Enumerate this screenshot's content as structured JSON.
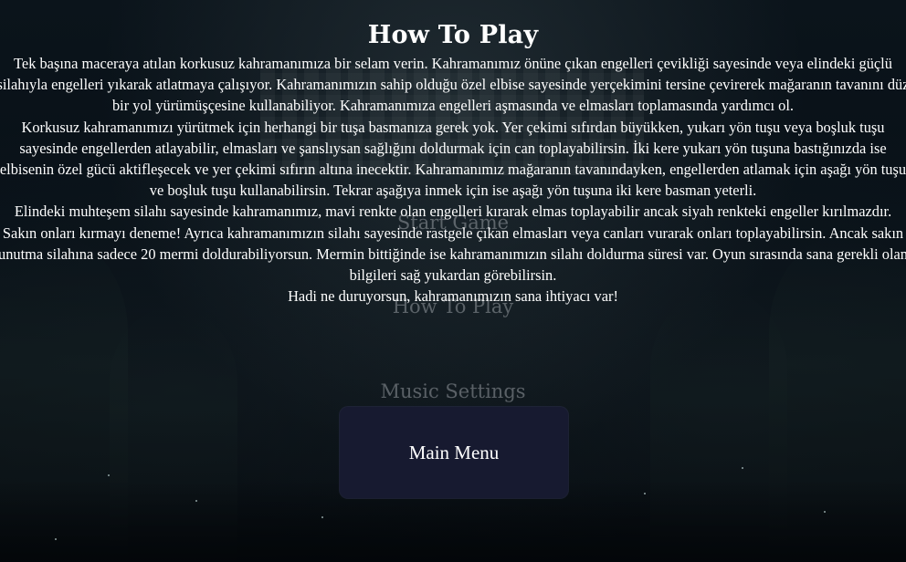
{
  "background": {
    "menu_ghost": {
      "start_game": "Start Game",
      "how_to_play": "How To Play",
      "music_settings": "Music Settings"
    }
  },
  "howto": {
    "title": "How To Play",
    "paragraphs": [
      "Tek başına maceraya atılan korkusuz kahramanımıza bir selam verin. Kahramanımız önüne çıkan engelleri çevikliği sayesinde veya elindeki güçlü silahıyla engelleri yıkarak atlatmaya çalışıyor. Kahramanımızın sahip olduğu özel elbise sayesinde yerçekimini tersine çevirerek mağaranın tavanını düz bir yol yürümüşçesine kullanabiliyor. Kahramanımıza engelleri aşmasında ve elmasları toplamasında yardımcı ol.",
      "Korkusuz kahramanımızı yürütmek için herhangi bir tuşa basmanıza gerek yok. Yer çekimi sıfırdan büyükken, yukarı yön tuşu veya boşluk tuşu sayesinde engellerden atlayabilir, elmasları ve şanslıysan sağlığını doldurmak için can toplayabilirsin. İki kere yukarı yön tuşuna bastığınızda ise elbisenin özel gücü aktifleşecek ve yer çekimi sıfırın altına inecektir. Kahramanımız mağaranın tavanındayken, engellerden atlamak için aşağı yön tuşu ve boşluk tuşu kullanabilirsin. Tekrar aşağıya inmek için ise aşağı yön tuşuna iki kere basman yeterli.",
      "Elindeki muhteşem silahı sayesinde kahramanımız, mavi renkte olan engelleri kırarak elmas toplayabilir ancak siyah renkteki engeller kırılmazdır. Sakın onları kırmayı deneme! Ayrıca kahramanımızın silahı sayesinde rastgele çıkan elmasları veya canları vurarak onları toplayabilirsin. Ancak sakın unutma silahına sadece 20 mermi doldurabiliyorsun. Mermin bittiğinde ise kahramanımızın silahı doldurma süresi var. Oyun sırasında sana gerekli olan bilgileri sağ yukardan görebilirsin.",
      "Hadi ne duruyorsun, kahramanımızın sana ihtiyacı var!"
    ],
    "main_menu_button": "Main Menu"
  },
  "colors": {
    "button_bg": "#171a30",
    "text": "#ffffff",
    "ghost_text": "#96999f"
  }
}
